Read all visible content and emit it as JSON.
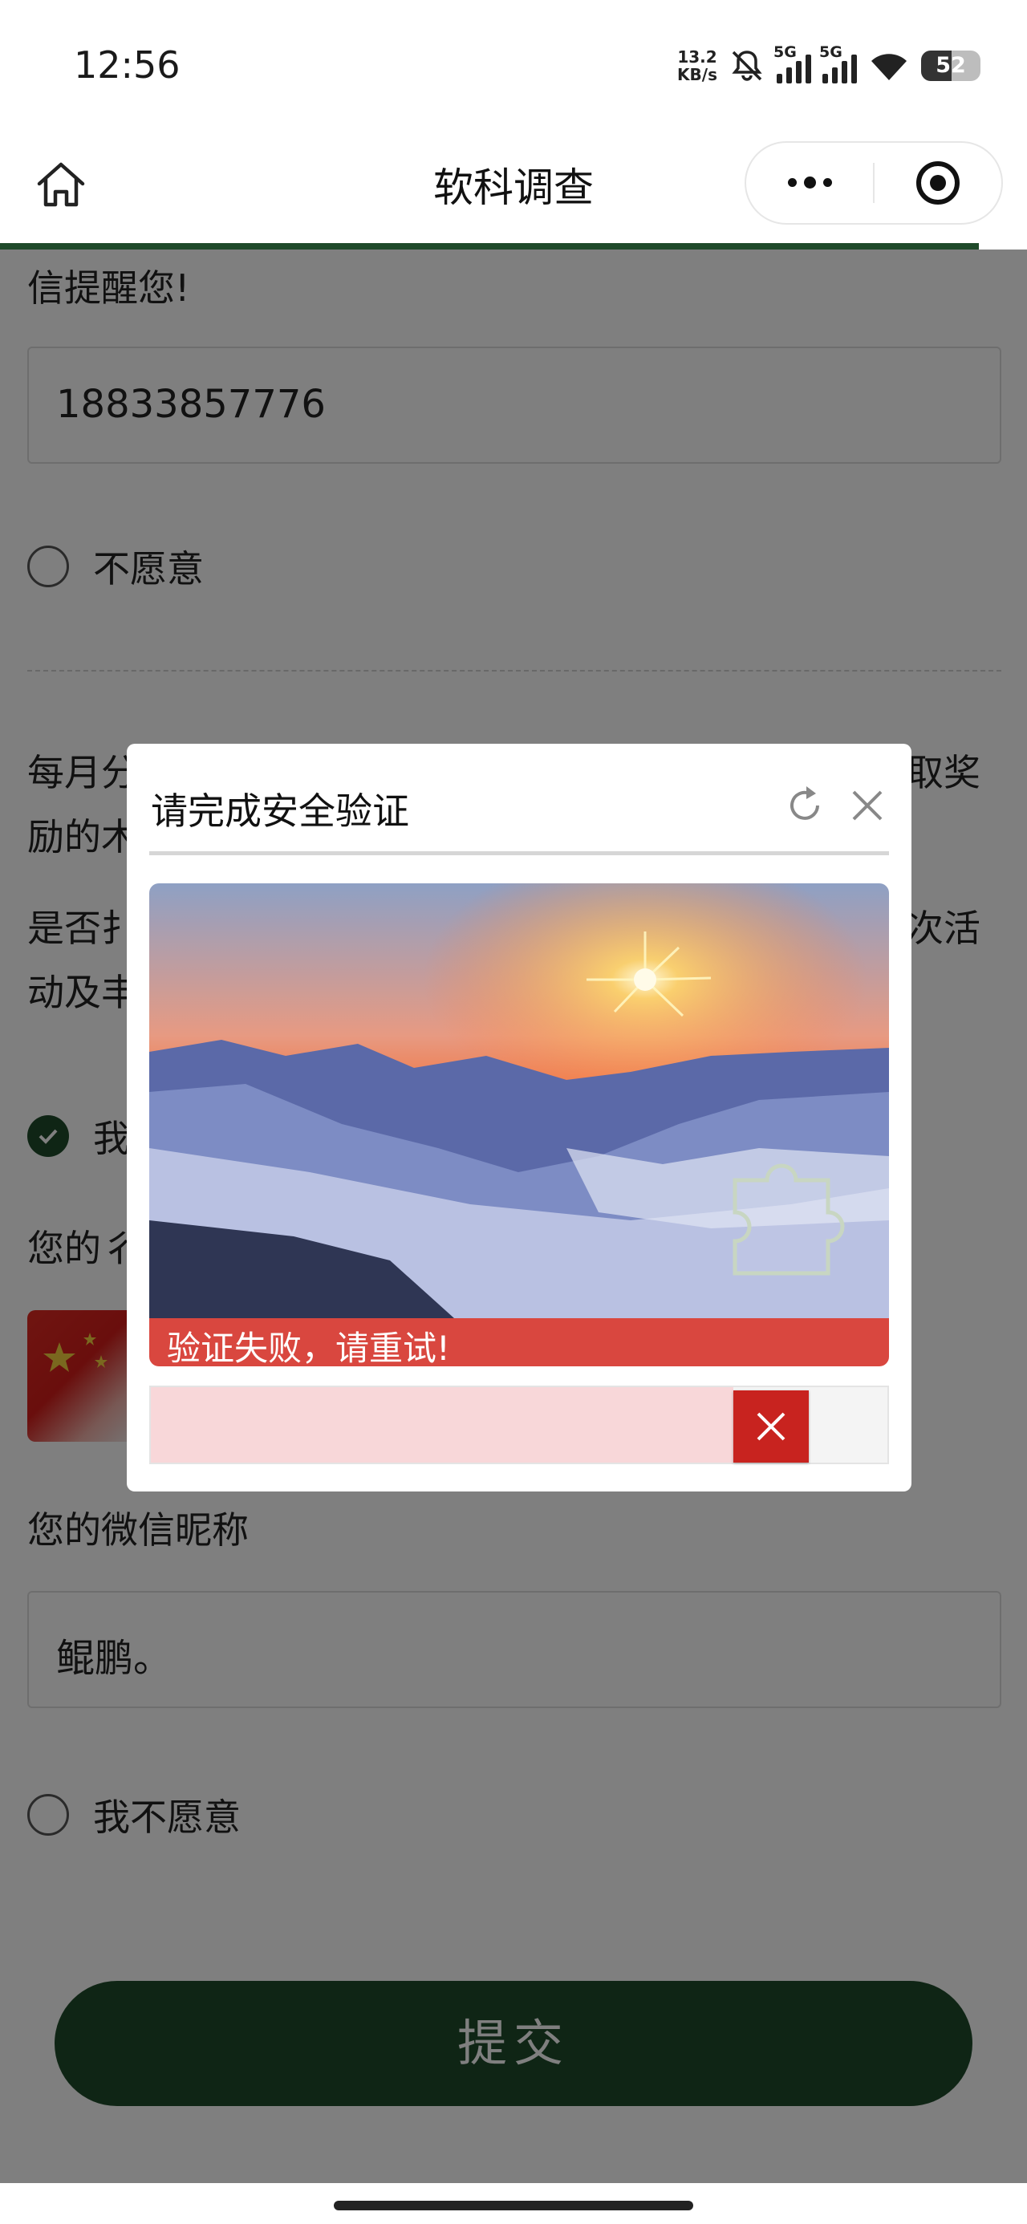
{
  "status_bar": {
    "time": "12:56",
    "net_speed_value": "13.2",
    "net_speed_unit": "KB/s",
    "sim1_label": "5G",
    "sim2_label": "5G",
    "battery": "52"
  },
  "header": {
    "title": "软科调查",
    "home_icon": "home-icon",
    "more_icon": "more-dots-icon",
    "close_icon": "target-circle-icon"
  },
  "form": {
    "reminder_tail": "信提醒您!",
    "phone_value": "18833857776",
    "option_unwilling": "不愿意",
    "monthly_line1_left": "每月分",
    "monthly_line1_right": "取奖",
    "monthly_line2_left": "励的木",
    "question_line1_left": "是否扌",
    "question_line1_right": "次活",
    "question_line2_left": "动及丰",
    "option_willing_partial": "我",
    "wechat_avatar_label_partial": "您的彳",
    "wechat_nickname_label": "您的微信昵称",
    "wechat_nickname_value": "鲲鹏。",
    "option_i_unwilling": "我不愿意",
    "submit_label": "提交"
  },
  "captcha": {
    "title": "请完成安全验证",
    "refresh_icon": "refresh-icon",
    "close_icon": "close-icon",
    "image_icon": "puzzle-piece-icon",
    "fail_message": "验证失败，请重试!",
    "slider_icon": "x-icon",
    "slider_progress_pct": 79
  },
  "colors": {
    "brand_green": "#1f4a2a",
    "error_red": "#c8231f",
    "fail_banner": "#d9473f"
  }
}
